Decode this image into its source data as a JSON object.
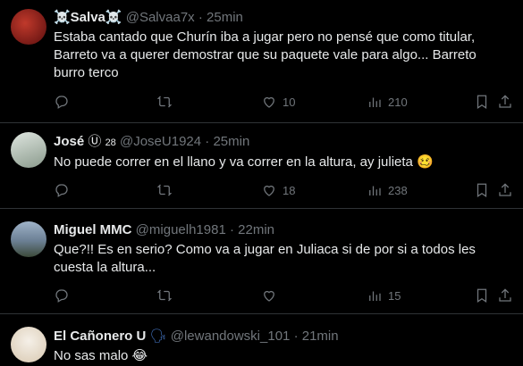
{
  "tweets": [
    {
      "name": "☠️Salva☠️",
      "handle": "@Salvaa7x",
      "sep": "·",
      "time": "25min",
      "text": "Estaba cantado que Churín iba a jugar pero no pensé que como titular, Barreto va a querer demostrar que su paquete vale para algo... Barreto burro terco",
      "likes": "10",
      "views": "210",
      "replies": "",
      "retweets": ""
    },
    {
      "name": "José",
      "badge": "28",
      "handle": "@JoseU1924",
      "sep": "·",
      "time": "25min",
      "text": "No puede correr en el llano y va correr en la altura, ay julieta 🥴",
      "likes": "18",
      "views": "238",
      "replies": "",
      "retweets": ""
    },
    {
      "name": "Miguel MMC",
      "handle": "@miguelh1981",
      "sep": "·",
      "time": "22min",
      "text": "Que?!! Es en serio? Como va a jugar en Juliaca si de por si a todos les cuesta la altura...",
      "likes": "",
      "views": "15",
      "replies": "",
      "retweets": ""
    },
    {
      "name": "El Cañonero U",
      "handle": "@lewandowski_101",
      "sep": "·",
      "time": "21min",
      "text": "No sas malo 😂"
    }
  ],
  "icons": {
    "reply": "reply-icon",
    "retweet": "retweet-icon",
    "like": "heart-icon",
    "views": "views-icon",
    "bookmark": "bookmark-icon",
    "share": "share-icon"
  },
  "colors": {
    "background": "#000000",
    "text": "#e7e9ea",
    "muted": "#71767b",
    "divider": "#2f3336"
  }
}
